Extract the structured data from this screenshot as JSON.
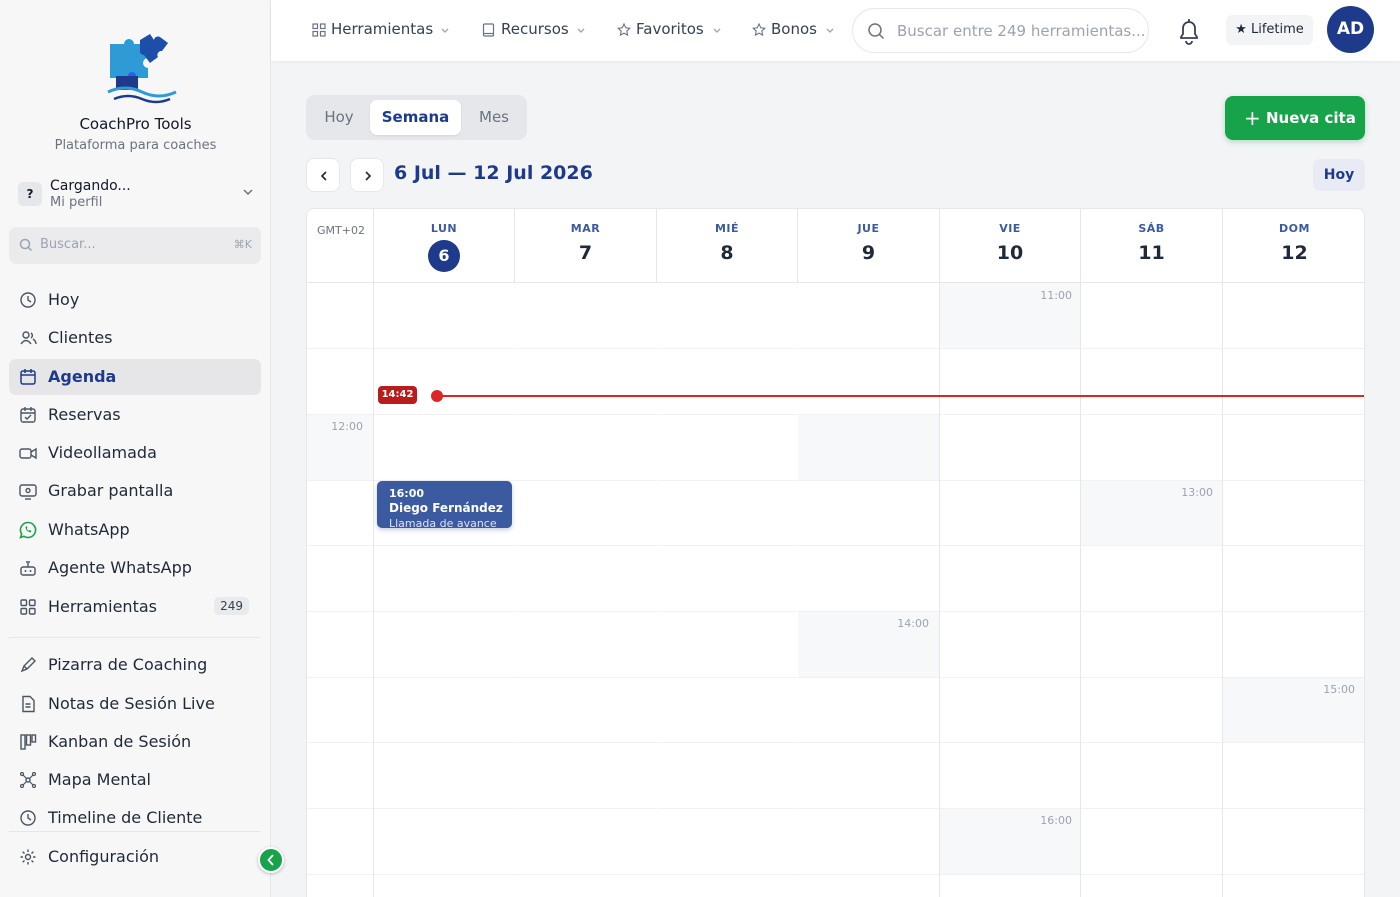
{
  "sidebar": {
    "brand_name": "CoachPro Tools",
    "brand_subtitle": "Plataforma para coaches",
    "profile": {
      "initial": "?",
      "name": "Cargando...",
      "subtitle": "Mi perfil"
    },
    "search": {
      "placeholder": "Buscar...",
      "shortcut": "⌘K"
    },
    "items": [
      {
        "label": "Hoy",
        "icon": "clock-icon"
      },
      {
        "label": "Clientes",
        "icon": "users-icon"
      },
      {
        "label": "Agenda",
        "icon": "calendar-icon",
        "active": true
      },
      {
        "label": "Reservas",
        "icon": "calendar-check-icon"
      },
      {
        "label": "Videollamada",
        "icon": "video-icon"
      },
      {
        "label": "Grabar pantalla",
        "icon": "screen-record-icon"
      },
      {
        "label": "WhatsApp",
        "icon": "whatsapp-icon"
      },
      {
        "label": "Agente WhatsApp",
        "icon": "bot-icon"
      },
      {
        "label": "Herramientas",
        "icon": "grid-icon",
        "badge": "249"
      },
      {
        "label": "Pizarra de Coaching",
        "icon": "pen-icon"
      },
      {
        "label": "Notas de Sesión Live",
        "icon": "document-icon"
      },
      {
        "label": "Kanban de Sesión",
        "icon": "kanban-icon"
      },
      {
        "label": "Mapa Mental",
        "icon": "mindmap-icon"
      },
      {
        "label": "Timeline de Cliente",
        "icon": "clock-icon"
      },
      {
        "label": "Configuración",
        "icon": "gear-icon"
      }
    ]
  },
  "topbar": {
    "nav": [
      {
        "label": "Herramientas",
        "icon": "grid-icon"
      },
      {
        "label": "Recursos",
        "icon": "book-icon"
      },
      {
        "label": "Favoritos",
        "icon": "star-icon"
      },
      {
        "label": "Bonos",
        "icon": "star-icon"
      }
    ],
    "search_placeholder": "Buscar entre 249 herramientas...",
    "lifetime_label": "★ Lifetime",
    "user_initials": "AD"
  },
  "calendar": {
    "views": [
      "Hoy",
      "Semana",
      "Mes"
    ],
    "active_view": "Semana",
    "new_button": "Nueva cita",
    "range_title": "6 Jul — 12 Jul 2026",
    "today_button": "Hoy",
    "timezone": "GMT+02",
    "days": [
      {
        "name": "LUN",
        "num": "6",
        "today": true
      },
      {
        "name": "MAR",
        "num": "7"
      },
      {
        "name": "MIÉ",
        "num": "8"
      },
      {
        "name": "JUE",
        "num": "9"
      },
      {
        "name": "VIE",
        "num": "10"
      },
      {
        "name": "SÁB",
        "num": "11"
      },
      {
        "name": "DOM",
        "num": "12"
      }
    ],
    "hour_labels": [
      "11:00",
      "12:00",
      "13:00",
      "14:00",
      "15:00",
      "16:00"
    ],
    "now_time": "14:42",
    "event": {
      "time": "16:00",
      "title": "Diego Fernández",
      "description": "Llamada de avance"
    }
  },
  "colors": {
    "accent": "#1e3a8a",
    "success": "#16a34a",
    "now": "#dc2626",
    "event": "#3b5aa0"
  }
}
